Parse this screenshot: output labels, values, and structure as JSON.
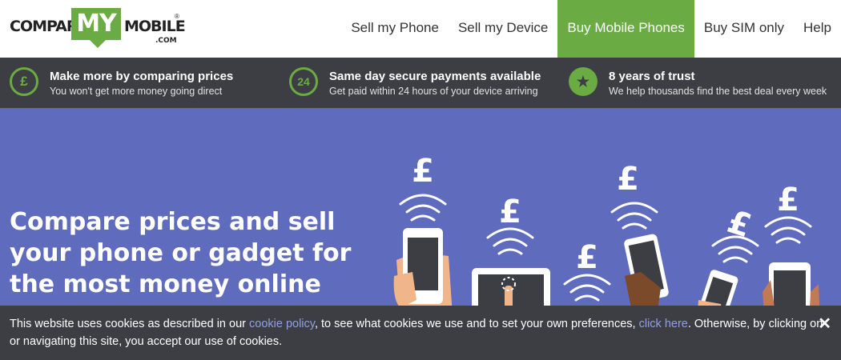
{
  "logo": {
    "word1": "COMPARE",
    "word2": "MY",
    "word3": "MOBILE",
    "reg": "®",
    "tld": ".COM"
  },
  "nav": [
    {
      "label": "Sell my Phone"
    },
    {
      "label": "Sell my Device"
    },
    {
      "label": "Buy Mobile Phones",
      "active": true
    },
    {
      "label": "Buy SIM only"
    },
    {
      "label": "Help"
    }
  ],
  "usps": [
    {
      "icon": "pound-circle-icon",
      "glyph": "£",
      "title": "Make more by comparing prices",
      "sub": "You won't get more money going direct"
    },
    {
      "icon": "24-hour-icon",
      "glyph": "24",
      "title": "Same day secure payments available",
      "sub": "Get paid within 24 hours of your device arriving"
    },
    {
      "icon": "star-icon",
      "glyph": "★",
      "title": "8 years of trust",
      "sub": "We help thousands find the best deal every week"
    }
  ],
  "hero": {
    "headline": "Compare prices and sell your phone or gadget for the most money online",
    "pound": "£"
  },
  "cookie": {
    "text1": "This website uses cookies as described in our ",
    "link1": "cookie policy",
    "text2": ", to see what cookies we use and to set your own preferences, ",
    "link2": "click here",
    "text3": ". Otherwise, by clicking on or navigating this site, you accept our use of cookies.",
    "close": "✕"
  },
  "colors": {
    "brand_green": "#6aab44",
    "dark_bar": "#3d3e44",
    "hero_bg": "#5f6bbd",
    "link": "#8fa0e6"
  }
}
